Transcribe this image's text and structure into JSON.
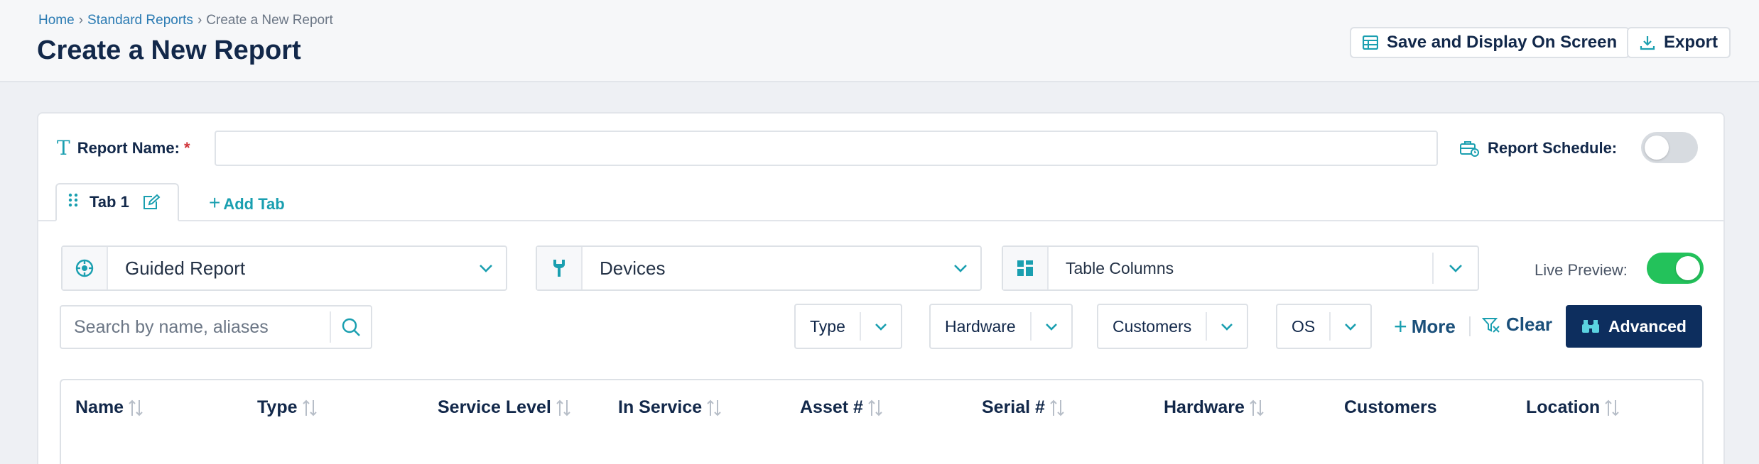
{
  "breadcrumb": {
    "home": "Home",
    "sep1": "›",
    "reports": "Standard Reports",
    "sep2": "›",
    "current": "Create a New Report"
  },
  "page": {
    "title": "Create a New Report"
  },
  "header_actions": {
    "save_display": "Save and Display On Screen",
    "export": "Export"
  },
  "form": {
    "report_name_label": "Report Name:",
    "required_mark": "*",
    "report_name_value": "",
    "report_schedule_label": "Report Schedule:",
    "report_schedule_enabled": false
  },
  "tabs": {
    "items": [
      {
        "label": "Tab 1",
        "active": true
      }
    ],
    "add_tab": "Add Tab",
    "add_plus": "+"
  },
  "selectors": {
    "report_type": "Guided Report",
    "entity": "Devices",
    "columns": "Table Columns"
  },
  "live_preview": {
    "label": "Live Preview:",
    "enabled": true
  },
  "search": {
    "placeholder": "Search by name, aliases"
  },
  "filters": [
    "Type",
    "Hardware",
    "Customers",
    "OS"
  ],
  "actions": {
    "more": "More",
    "more_plus": "+",
    "clear": "Clear",
    "advanced": "Advanced"
  },
  "table": {
    "columns": [
      {
        "label": "Name",
        "sortable": true
      },
      {
        "label": "Type",
        "sortable": true
      },
      {
        "label": "Service Level",
        "sortable": true
      },
      {
        "label": "In Service",
        "sortable": true
      },
      {
        "label": "Asset #",
        "sortable": true
      },
      {
        "label": "Serial #",
        "sortable": true
      },
      {
        "label": "Hardware",
        "sortable": true
      },
      {
        "label": "Customers",
        "sortable": false
      },
      {
        "label": "Location",
        "sortable": true
      }
    ]
  },
  "colors": {
    "accent": "#1a9fb0",
    "navy": "#12284a",
    "primary_button": "#0d2e5e",
    "toggle_on": "#23c25b",
    "required": "#d0343a"
  }
}
